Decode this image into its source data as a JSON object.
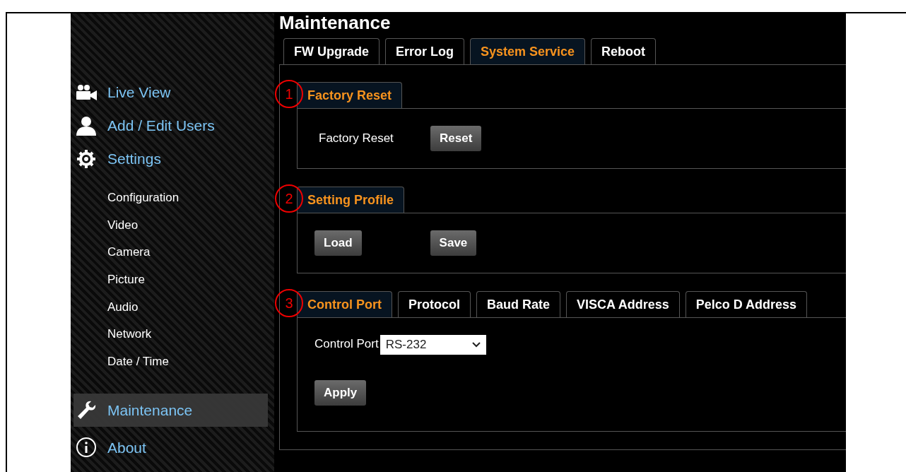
{
  "sidebar": {
    "main_items": [
      {
        "kind": "camera",
        "label": "Live View",
        "selected": false
      },
      {
        "kind": "user",
        "label": "Add / Edit Users",
        "selected": false
      },
      {
        "kind": "gear",
        "label": "Settings",
        "selected": false
      }
    ],
    "sub_items": [
      {
        "label": "Configuration"
      },
      {
        "label": "Video"
      },
      {
        "label": "Camera"
      },
      {
        "label": "Picture"
      },
      {
        "label": "Audio"
      },
      {
        "label": "Network"
      },
      {
        "label": "Date / Time"
      }
    ],
    "bottom_items": [
      {
        "kind": "wrench",
        "label": "Maintenance",
        "selected": true
      },
      {
        "kind": "info",
        "label": "About",
        "selected": false
      }
    ]
  },
  "page_title": "Maintenance",
  "tabs": [
    {
      "label": "FW Upgrade",
      "selected": false
    },
    {
      "label": "Error Log",
      "selected": false
    },
    {
      "label": "System Service",
      "selected": true
    },
    {
      "label": "Reboot",
      "selected": false
    }
  ],
  "sections": [
    {
      "marker": "1",
      "tabs": [
        {
          "label": "Factory Reset",
          "selected": true
        }
      ],
      "kind": "reset",
      "label": "Factory Reset",
      "buttons": [
        "Reset"
      ]
    },
    {
      "marker": "2",
      "tabs": [
        {
          "label": "Setting Profile",
          "selected": true
        }
      ],
      "kind": "profile",
      "buttons": [
        "Load",
        "Save"
      ]
    },
    {
      "marker": "3",
      "tabs": [
        {
          "label": "Control Port",
          "selected": true
        },
        {
          "label": "Protocol",
          "selected": false
        },
        {
          "label": "Baud Rate",
          "selected": false
        },
        {
          "label": "VISCA Address",
          "selected": false
        },
        {
          "label": "Pelco D Address",
          "selected": false
        }
      ],
      "kind": "port",
      "label": "Control Port",
      "value": "RS-232",
      "buttons": [
        "Apply"
      ]
    }
  ]
}
